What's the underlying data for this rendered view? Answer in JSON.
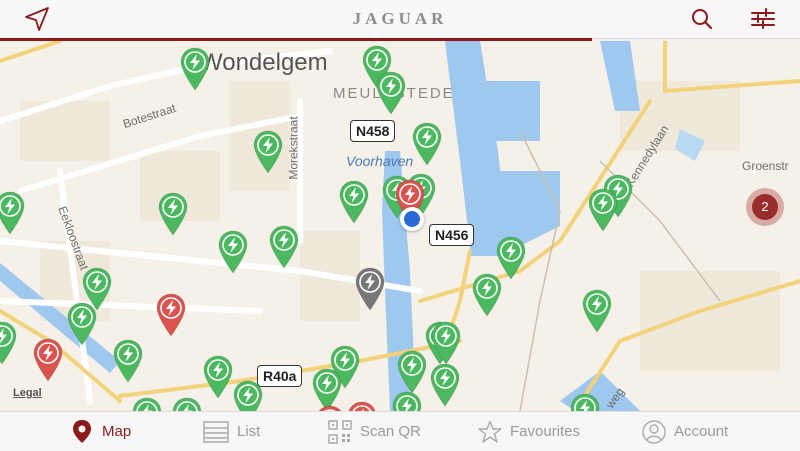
{
  "header": {
    "brand": "JAGUAR",
    "search_icon": "search-icon",
    "filter_icon": "sliders-icon",
    "locate_icon": "location-arrow-icon"
  },
  "colors": {
    "accent": "#8b1a1a",
    "available": "#4cb860",
    "occupied": "#d9534f",
    "offline": "#777777",
    "water": "#9fc8ee",
    "cluster": "#9b2c2c"
  },
  "loading_progress": 0.74,
  "map": {
    "area_labels": [
      "Wondelgem",
      "MEULESTEDE"
    ],
    "water_labels": [
      "Voorhaven"
    ],
    "street_labels": [
      "Botestraat",
      "Morekstraat",
      "Eekloostraat",
      "Kennedylaan",
      "Groenstr",
      "weg"
    ],
    "road_shields": [
      "N458",
      "N456",
      "R40a"
    ],
    "cluster_count": "2",
    "legal": "Legal"
  },
  "tabs": [
    {
      "label": "Map",
      "icon": "map-pin-icon",
      "active": true
    },
    {
      "label": "List",
      "icon": "list-icon",
      "active": false
    },
    {
      "label": "Scan QR",
      "icon": "qr-code-icon",
      "active": false
    },
    {
      "label": "Favourites",
      "icon": "star-icon",
      "active": false
    },
    {
      "label": "Account",
      "icon": "user-icon",
      "active": false
    }
  ]
}
